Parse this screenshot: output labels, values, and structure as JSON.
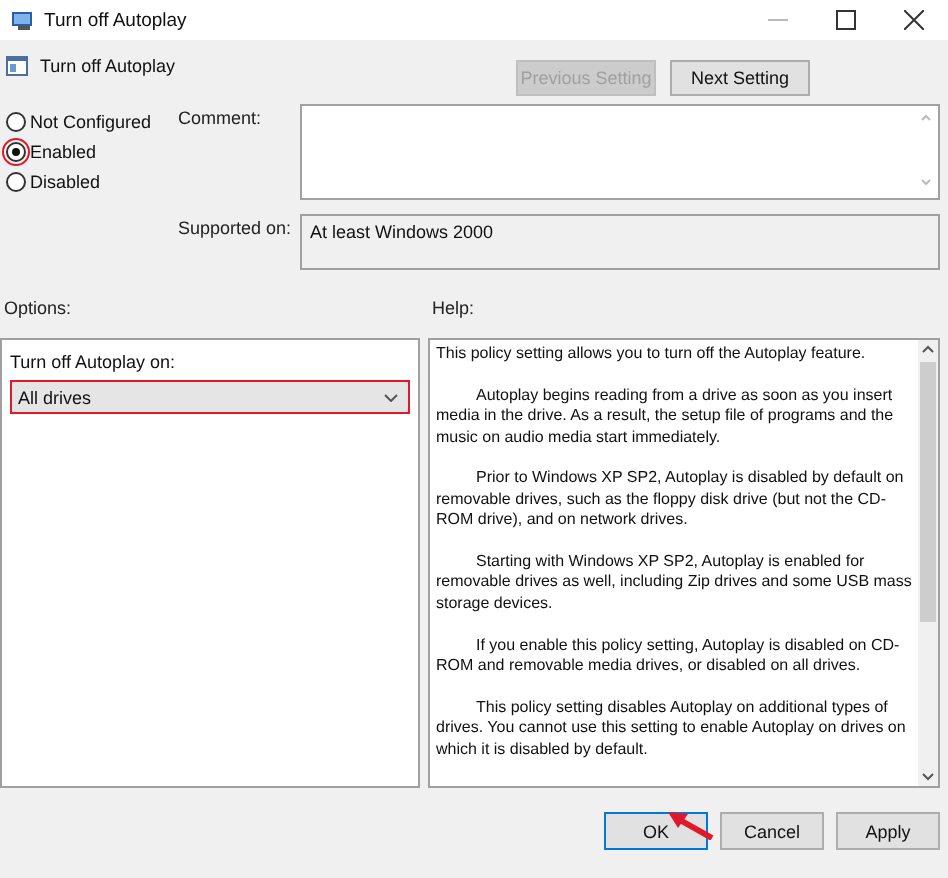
{
  "window": {
    "title": "Turn off Autoplay"
  },
  "policy": {
    "title": "Turn off Autoplay"
  },
  "nav_buttons": [
    {
      "label": "Previous Setting",
      "disabled": true
    },
    {
      "label": "Next Setting",
      "disabled": false
    }
  ],
  "states": [
    {
      "label": "Not Configured",
      "selected": false,
      "highlighted": false
    },
    {
      "label": "Enabled",
      "selected": true,
      "highlighted": true
    },
    {
      "label": "Disabled",
      "selected": false,
      "highlighted": false
    }
  ],
  "comment": {
    "label": "Comment:"
  },
  "supported_on": {
    "label": "Supported on:",
    "value": "At least Windows 2000"
  },
  "options": {
    "label": "Options:",
    "field_label": "Turn off Autoplay on:",
    "dropdown": {
      "value": "All drives",
      "highlighted": true
    }
  },
  "help": {
    "label": "Help:",
    "paragraphs": [
      "This policy setting allows you to turn off the Autoplay feature.",
      "Autoplay begins reading from a drive as soon as you insert media in the drive. As a result, the setup file of programs and the music on audio media start immediately.",
      "Prior to Windows XP SP2, Autoplay is disabled by default on removable drives, such as the floppy disk drive (but not the CD-ROM drive), and on network drives.",
      "Starting with Windows XP SP2, Autoplay is enabled for removable drives as well, including Zip drives and some USB mass storage devices.",
      "If you enable this policy setting, Autoplay is disabled on CD-ROM and removable media drives, or disabled on all drives.",
      "This policy setting disables Autoplay on additional types of drives. You cannot use this setting to enable Autoplay on drives on which it is disabled by default."
    ]
  },
  "buttons": [
    {
      "label": "OK",
      "default": true,
      "pointed_at": true
    },
    {
      "label": "Cancel",
      "default": false,
      "pointed_at": false
    },
    {
      "label": "Apply",
      "default": false,
      "pointed_at": false
    }
  ]
}
